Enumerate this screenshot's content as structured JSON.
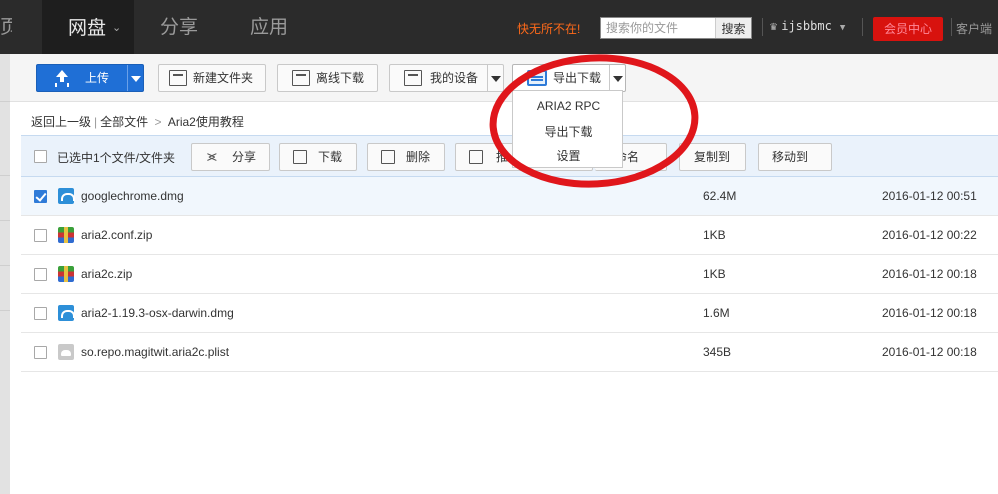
{
  "nav": {
    "home": "页",
    "netdisk": "网盘",
    "share": "分享",
    "apps": "应用",
    "slogan": "快无所不在!",
    "search_placeholder": "搜索你的文件",
    "search_button": "搜索",
    "username": "ijsbbmc",
    "vip": "会员中心",
    "client": "客户端"
  },
  "toolbar": {
    "upload": "上传",
    "new_folder": "新建文件夹",
    "offline_download": "离线下载",
    "my_devices": "我的设备",
    "export_download": "导出下载"
  },
  "export_menu": [
    "ARIA2 RPC",
    "导出下载",
    "设置"
  ],
  "breadcrumb": {
    "back": "返回上一级",
    "all": "全部文件",
    "current": "Aria2使用教程"
  },
  "selection": {
    "text": "已选中1个文件/文件夹",
    "share": "分享",
    "download": "下载",
    "delete": "删除",
    "push": "推",
    "rename": "重命名",
    "copy_to": "复制到",
    "move_to": "移动到"
  },
  "files": [
    {
      "name": "googlechrome.dmg",
      "size": "62.4M",
      "date": "2016-01-12 00:51",
      "icon": "dmg-icon",
      "checked": true
    },
    {
      "name": "aria2.conf.zip",
      "size": "1KB",
      "date": "2016-01-12 00:22",
      "icon": "zip-icon",
      "checked": false
    },
    {
      "name": "aria2c.zip",
      "size": "1KB",
      "date": "2016-01-12 00:18",
      "icon": "zip-icon",
      "checked": false
    },
    {
      "name": "aria2-1.19.3-osx-darwin.dmg",
      "size": "1.6M",
      "date": "2016-01-12 00:18",
      "icon": "dmg-icon",
      "checked": false
    },
    {
      "name": "so.repo.magitwit.aria2c.plist",
      "size": "345B",
      "date": "2016-01-12 00:18",
      "icon": "plist-icon",
      "checked": false
    }
  ],
  "colors": {
    "accent": "#1f6fd6",
    "annotation": "#e0161b",
    "topbar": "#2b2b2b"
  }
}
